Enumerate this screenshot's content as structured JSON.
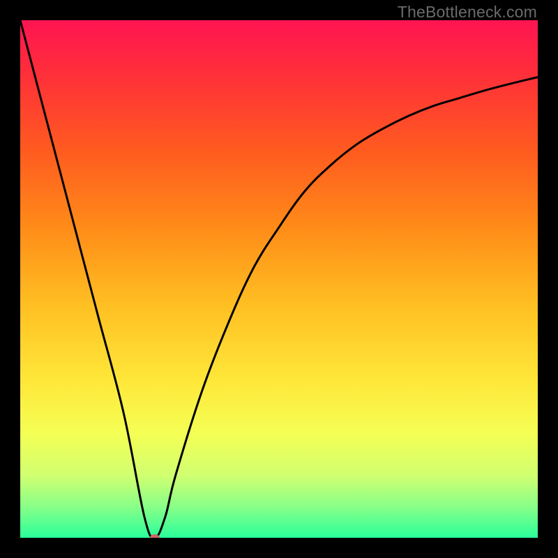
{
  "watermark": "TheBottleneck.com",
  "chart_data": {
    "type": "line",
    "title": "",
    "xlabel": "",
    "ylabel": "",
    "xlim": [
      0,
      100
    ],
    "ylim": [
      0,
      100
    ],
    "grid": false,
    "legend": false,
    "note": "V-shaped bottleneck curve. Minimum (y≈0) occurs near x≈26. Left branch is nearly linear descending from top-left; right branch rises with decreasing slope toward top-right.",
    "series": [
      {
        "name": "curve",
        "x": [
          0,
          5,
          10,
          15,
          20,
          24,
          26,
          28,
          30,
          35,
          40,
          45,
          50,
          55,
          60,
          65,
          70,
          75,
          80,
          85,
          90,
          95,
          100
        ],
        "values": [
          100,
          81,
          62,
          43,
          24,
          4,
          0,
          4,
          12,
          28,
          41,
          52,
          60,
          67,
          72,
          76,
          79,
          81.5,
          83.5,
          85,
          86.5,
          87.8,
          89
        ]
      }
    ],
    "marker": {
      "x": 26,
      "y": 0,
      "color": "#cc6666",
      "rx": 7,
      "ry": 5
    },
    "background_gradient": {
      "stops": [
        {
          "offset": 0.0,
          "color": "#ff1452"
        },
        {
          "offset": 0.1,
          "color": "#ff2e3a"
        },
        {
          "offset": 0.25,
          "color": "#ff5a20"
        },
        {
          "offset": 0.4,
          "color": "#ff8b18"
        },
        {
          "offset": 0.55,
          "color": "#ffbf22"
        },
        {
          "offset": 0.7,
          "color": "#ffe83a"
        },
        {
          "offset": 0.8,
          "color": "#f4ff55"
        },
        {
          "offset": 0.88,
          "color": "#d0ff70"
        },
        {
          "offset": 0.94,
          "color": "#88ff88"
        },
        {
          "offset": 1.0,
          "color": "#2aff9a"
        }
      ]
    }
  }
}
